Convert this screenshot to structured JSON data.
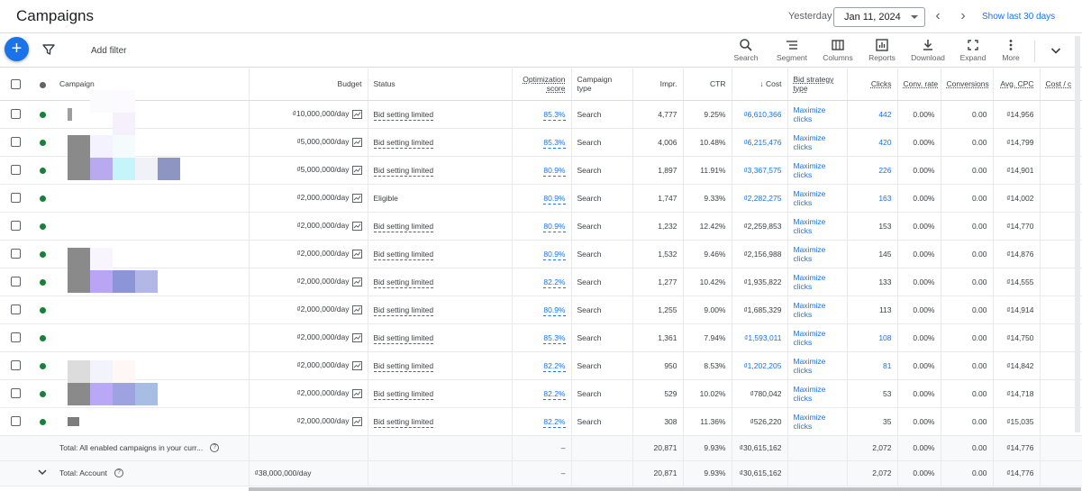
{
  "header": {
    "title": "Campaigns",
    "yesterday_label": "Yesterday",
    "date_value": "Jan 11, 2024",
    "show_last_label": "Show last 30 days"
  },
  "toolbar": {
    "add_filter": "Add filter",
    "tools": [
      {
        "label": "Search",
        "icon": "search-icon"
      },
      {
        "label": "Segment",
        "icon": "segment-icon"
      },
      {
        "label": "Columns",
        "icon": "columns-icon"
      },
      {
        "label": "Reports",
        "icon": "reports-icon"
      },
      {
        "label": "Download",
        "icon": "download-icon"
      },
      {
        "label": "Expand",
        "icon": "expand-icon"
      },
      {
        "label": "More",
        "icon": "more-icon"
      }
    ]
  },
  "table": {
    "columns": {
      "campaign": "Campaign",
      "budget": "Budget",
      "status": "Status",
      "opt_score_1": "Optimization",
      "opt_score_2": "score",
      "campaign_type_1": "Campaign",
      "campaign_type_2": "type",
      "impr": "Impr.",
      "ctr": "CTR",
      "cost": "Cost",
      "bid_strategy_1": "Bid strategy",
      "bid_strategy_2": "type",
      "clicks": "Clicks",
      "conv_rate": "Conv. rate",
      "conversions": "Conversions",
      "avg_cpc": "Avg. CPC",
      "cost_conv": "Cost / c"
    },
    "rows": [
      {
        "budget": "₫10,000,000/day",
        "status": "Bid setting limited",
        "opt": "85.3%",
        "type": "Search",
        "impr": "4,777",
        "ctr": "9.25%",
        "cost": "₫6,610,366",
        "cost_link": true,
        "bid1": "Maximize",
        "bid2": "clicks",
        "clicks": "442",
        "clicks_link": true,
        "conv_rate": "0.00%",
        "conv": "0.00",
        "cpc": "₫14,956"
      },
      {
        "budget": "₫5,000,000/day",
        "status": "Bid setting limited",
        "opt": "85.3%",
        "type": "Search",
        "impr": "4,006",
        "ctr": "10.48%",
        "cost": "₫6,215,476",
        "cost_link": true,
        "bid1": "Maximize",
        "bid2": "clicks",
        "clicks": "420",
        "clicks_link": true,
        "conv_rate": "0.00%",
        "conv": "0.00",
        "cpc": "₫14,799"
      },
      {
        "budget": "₫5,000,000/day",
        "status": "Bid setting limited",
        "opt": "80.9%",
        "type": "Search",
        "impr": "1,897",
        "ctr": "11.91%",
        "cost": "₫3,367,575",
        "cost_link": true,
        "bid1": "Maximize",
        "bid2": "clicks",
        "clicks": "226",
        "clicks_link": true,
        "conv_rate": "0.00%",
        "conv": "0.00",
        "cpc": "₫14,901"
      },
      {
        "budget": "₫2,000,000/day",
        "status": "Eligible",
        "opt": "80.9%",
        "type": "Search",
        "impr": "1,747",
        "ctr": "9.33%",
        "cost": "₫2,282,275",
        "cost_link": true,
        "bid1": "Maximize",
        "bid2": "clicks",
        "clicks": "163",
        "clicks_link": true,
        "conv_rate": "0.00%",
        "conv": "0.00",
        "cpc": "₫14,002"
      },
      {
        "budget": "₫2,000,000/day",
        "status": "Bid setting limited",
        "opt": "80.9%",
        "type": "Search",
        "impr": "1,232",
        "ctr": "12.42%",
        "cost": "₫2,259,853",
        "cost_link": false,
        "bid1": "Maximize",
        "bid2": "clicks",
        "clicks": "153",
        "clicks_link": false,
        "conv_rate": "0.00%",
        "conv": "0.00",
        "cpc": "₫14,770"
      },
      {
        "budget": "₫2,000,000/day",
        "status": "Bid setting limited",
        "opt": "80.9%",
        "type": "Search",
        "impr": "1,532",
        "ctr": "9.46%",
        "cost": "₫2,156,988",
        "cost_link": false,
        "bid1": "Maximize",
        "bid2": "clicks",
        "clicks": "145",
        "clicks_link": false,
        "conv_rate": "0.00%",
        "conv": "0.00",
        "cpc": "₫14,876"
      },
      {
        "budget": "₫2,000,000/day",
        "status": "Bid setting limited",
        "opt": "82.2%",
        "type": "Search",
        "impr": "1,277",
        "ctr": "10.42%",
        "cost": "₫1,935,822",
        "cost_link": false,
        "bid1": "Maximize",
        "bid2": "clicks",
        "clicks": "133",
        "clicks_link": false,
        "conv_rate": "0.00%",
        "conv": "0.00",
        "cpc": "₫14,555"
      },
      {
        "budget": "₫2,000,000/day",
        "status": "Bid setting limited",
        "opt": "80.9%",
        "type": "Search",
        "impr": "1,255",
        "ctr": "9.00%",
        "cost": "₫1,685,329",
        "cost_link": false,
        "bid1": "Maximize",
        "bid2": "clicks",
        "clicks": "113",
        "clicks_link": false,
        "conv_rate": "0.00%",
        "conv": "0.00",
        "cpc": "₫14,914"
      },
      {
        "budget": "₫2,000,000/day",
        "status": "Bid setting limited",
        "opt": "85.3%",
        "type": "Search",
        "impr": "1,361",
        "ctr": "7.94%",
        "cost": "₫1,593,011",
        "cost_link": true,
        "bid1": "Maximize",
        "bid2": "clicks",
        "clicks": "108",
        "clicks_link": true,
        "conv_rate": "0.00%",
        "conv": "0.00",
        "cpc": "₫14,750"
      },
      {
        "budget": "₫2,000,000/day",
        "status": "Bid setting limited",
        "opt": "82.2%",
        "type": "Search",
        "impr": "950",
        "ctr": "8.53%",
        "cost": "₫1,202,205",
        "cost_link": true,
        "bid1": "Maximize",
        "bid2": "clicks",
        "clicks": "81",
        "clicks_link": true,
        "conv_rate": "0.00%",
        "conv": "0.00",
        "cpc": "₫14,842"
      },
      {
        "budget": "₫2,000,000/day",
        "status": "Bid setting limited",
        "opt": "82.2%",
        "type": "Search",
        "impr": "529",
        "ctr": "10.02%",
        "cost": "₫780,042",
        "cost_link": false,
        "bid1": "Maximize",
        "bid2": "clicks",
        "clicks": "53",
        "clicks_link": false,
        "conv_rate": "0.00%",
        "conv": "0.00",
        "cpc": "₫14,718"
      },
      {
        "budget": "₫2,000,000/day",
        "status": "Bid setting limited",
        "opt": "82.2%",
        "type": "Search",
        "impr": "308",
        "ctr": "11.36%",
        "cost": "₫526,220",
        "cost_link": false,
        "bid1": "Maximize",
        "bid2": "clicks",
        "clicks": "35",
        "clicks_link": false,
        "conv_rate": "0.00%",
        "conv": "0.00",
        "cpc": "₫15,035"
      }
    ],
    "totals": [
      {
        "label": "Total: All enabled campaigns in your curr...",
        "budget": "",
        "opt": "–",
        "impr": "20,871",
        "ctr": "9.93%",
        "cost": "₫30,615,162",
        "clicks": "2,072",
        "conv_rate": "0.00%",
        "conv": "0.00",
        "cpc": "₫14,776"
      },
      {
        "label": "Total: Account",
        "budget": "₫38,000,000/day",
        "opt": "–",
        "impr": "20,871",
        "ctr": "9.93%",
        "cost": "₫30,615,162",
        "clicks": "2,072",
        "conv_rate": "0.00%",
        "conv": "0.00",
        "cpc": "₫14,776"
      }
    ]
  },
  "colors": {
    "accent": "#1a73e8",
    "enabled_dot": "#188038",
    "text": "#3c4043"
  }
}
